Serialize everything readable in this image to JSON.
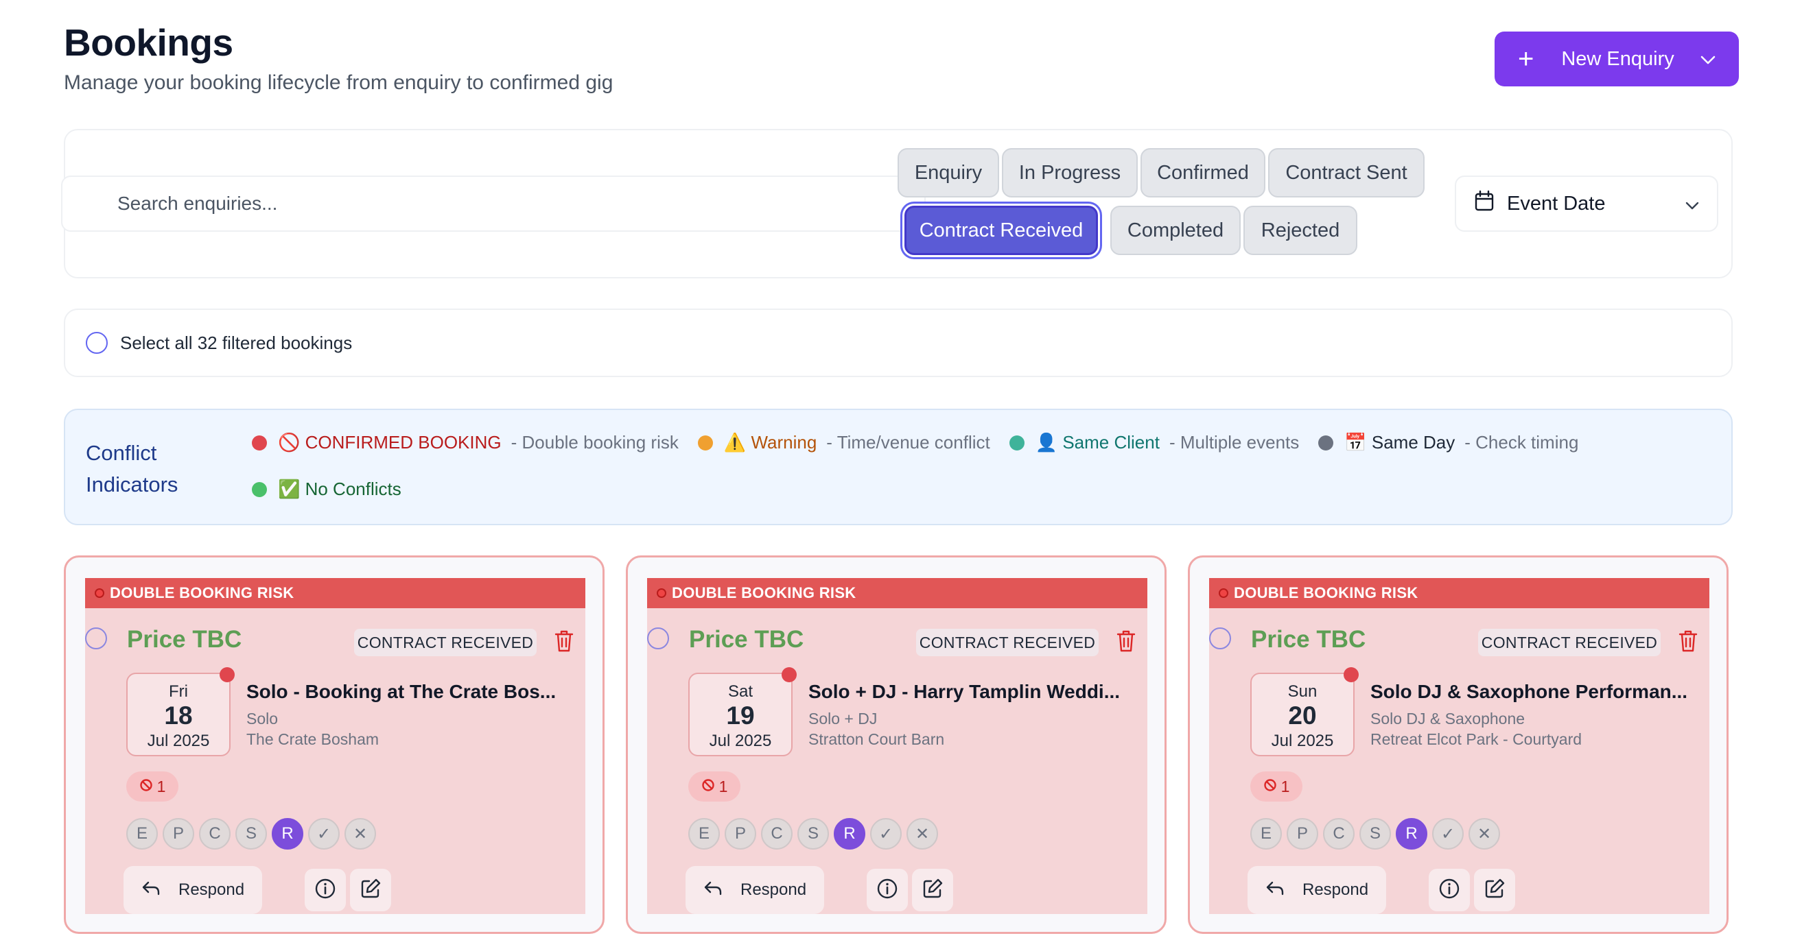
{
  "header": {
    "title": "Bookings",
    "subtitle": "Manage your booking lifecycle from enquiry to confirmed gig",
    "new_enquiry_label": "New Enquiry"
  },
  "filters": {
    "search_placeholder": "Search enquiries...",
    "chips": [
      {
        "label": "Enquiry",
        "active": false
      },
      {
        "label": "In Progress",
        "active": false
      },
      {
        "label": "Confirmed",
        "active": false
      },
      {
        "label": "Contract Sent",
        "active": false
      },
      {
        "label": "Contract Received",
        "active": true
      },
      {
        "label": "Completed",
        "active": false
      },
      {
        "label": "Rejected",
        "active": false
      }
    ],
    "sort_label": "Event Date"
  },
  "select_all": {
    "label": "Select all 32 filtered bookings"
  },
  "conflicts": {
    "title": "Conflict Indicators",
    "items": [
      {
        "label": "🚫 CONFIRMED BOOKING",
        "desc": "- Double booking risk",
        "color": "#e0464e",
        "text_color": "#b91c1c"
      },
      {
        "label": "⚠️ Warning",
        "desc": "- Time/venue conflict",
        "color": "#f0a030",
        "text_color": "#b45309"
      },
      {
        "label": "👤 Same Client",
        "desc": "- Multiple events",
        "color": "#3fb39a",
        "text_color": "#0f766e"
      },
      {
        "label": "📅 Same Day",
        "desc": "- Check timing",
        "color": "#6b7280",
        "text_color": "#1f2937"
      },
      {
        "label": "✅ No Conflicts",
        "desc": "",
        "color": "#4ac06a",
        "text_color": "#166534"
      }
    ]
  },
  "cards": [
    {
      "risk_label": "DOUBLE BOOKING RISK",
      "price": "Price TBC",
      "status": "CONTRACT RECEIVED",
      "dow": "Fri",
      "day": "18",
      "month": "Jul 2025",
      "title": "Solo - Booking at The Crate Bos...",
      "type": "Solo",
      "venue": "The Crate Bosham",
      "conflict_count": "1",
      "stages": [
        "E",
        "P",
        "C",
        "S",
        "R",
        "✓",
        "✕"
      ],
      "active_stage": "R",
      "respond_label": "Respond"
    },
    {
      "risk_label": "DOUBLE BOOKING RISK",
      "price": "Price TBC",
      "status": "CONTRACT RECEIVED",
      "dow": "Sat",
      "day": "19",
      "month": "Jul 2025",
      "title": "Solo + DJ - Harry Tamplin Weddi...",
      "type": "Solo + DJ",
      "venue": "Stratton Court Barn",
      "conflict_count": "1",
      "stages": [
        "E",
        "P",
        "C",
        "S",
        "R",
        "✓",
        "✕"
      ],
      "active_stage": "R",
      "respond_label": "Respond"
    },
    {
      "risk_label": "DOUBLE BOOKING RISK",
      "price": "Price TBC",
      "status": "CONTRACT RECEIVED",
      "dow": "Sun",
      "day": "20",
      "month": "Jul 2025",
      "title": "Solo DJ & Saxophone Performan...",
      "type": "Solo DJ & Saxophone",
      "venue": "Retreat Elcot Park - Courtyard",
      "conflict_count": "1",
      "stages": [
        "E",
        "P",
        "C",
        "S",
        "R",
        "✓",
        "✕"
      ],
      "active_stage": "R",
      "respond_label": "Respond"
    }
  ]
}
